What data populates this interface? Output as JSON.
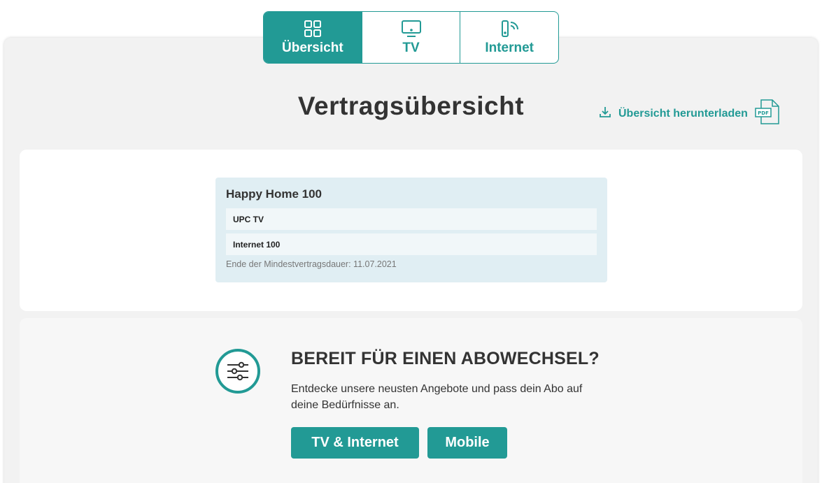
{
  "tabs": [
    {
      "label": "Übersicht",
      "icon": "grid-icon",
      "active": true
    },
    {
      "label": "TV",
      "icon": "tv-icon",
      "active": false
    },
    {
      "label": "Internet",
      "icon": "router-icon",
      "active": false
    }
  ],
  "page_title": "Vertragsübersicht",
  "download": {
    "label": "Übersicht herunterladen",
    "file_type": "PDF"
  },
  "contract": {
    "name": "Happy Home 100",
    "services": [
      "UPC TV",
      "Internet 100"
    ],
    "end_date_text": "Ende der Mindestvertragsdauer: 11.07.2021"
  },
  "promo": {
    "title": "BEREIT FÜR EINEN ABOWECHSEL?",
    "text": "Entdecke unsere neusten Angebote und pass dein Abo auf deine Bedürfnisse an.",
    "buttons": {
      "tv_internet": "TV & Internet",
      "mobile": "Mobile"
    }
  },
  "colors": {
    "accent": "#229a95",
    "contract_bg": "#e0eef3"
  }
}
